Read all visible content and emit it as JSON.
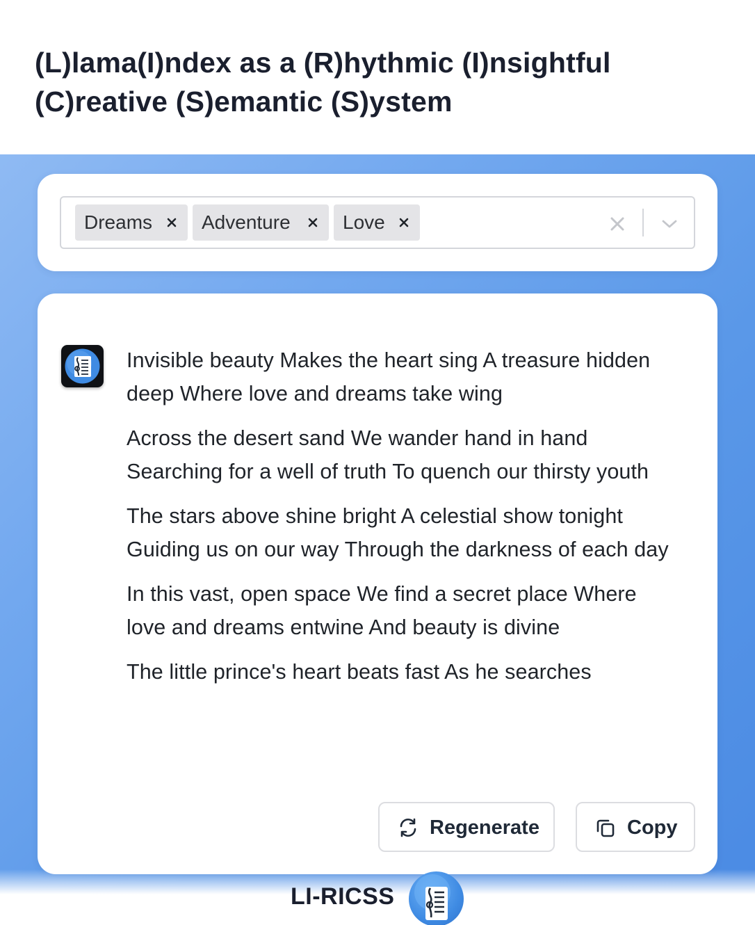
{
  "header": {
    "title": "(L)lama(I)ndex as a (R)hythmic (I)nsightful (C)reative (S)emantic (S)ystem"
  },
  "select": {
    "chips": [
      {
        "label": "Dreams",
        "remove_icon": "close-icon"
      },
      {
        "label": "Adventure",
        "remove_icon": "close-icon"
      },
      {
        "label": "Love",
        "remove_icon": "close-icon"
      }
    ],
    "clear_icon": "close-icon",
    "dropdown_icon": "chevron-down-icon"
  },
  "lyrics": {
    "stanzas": [
      "Invisible beauty Makes the heart sing A treasure hidden deep Where love and dreams take wing",
      "Across the desert sand We wander hand in hand Searching for a well of truth To quench our thirsty youth",
      "The stars above shine bright A celestial show tonight Guiding us on our way Through the darkness of each day",
      "In this vast, open space We find a secret place Where love and dreams entwine And beauty is divine",
      "The little prince's heart beats fast As he searches"
    ]
  },
  "actions": {
    "regenerate_label": "Regenerate",
    "regenerate_icon": "refresh-icon",
    "copy_label": "Copy",
    "copy_icon": "copy-icon"
  },
  "footer": {
    "brand": "LI-RICSS",
    "logo_icon": "music-sheet-icon"
  },
  "colors": {
    "background_gradient_start": "#8fbaf3",
    "background_gradient_end": "#4a8ae3",
    "chip_bg": "#e4e4e7",
    "text_dark": "#1a1f2e"
  }
}
